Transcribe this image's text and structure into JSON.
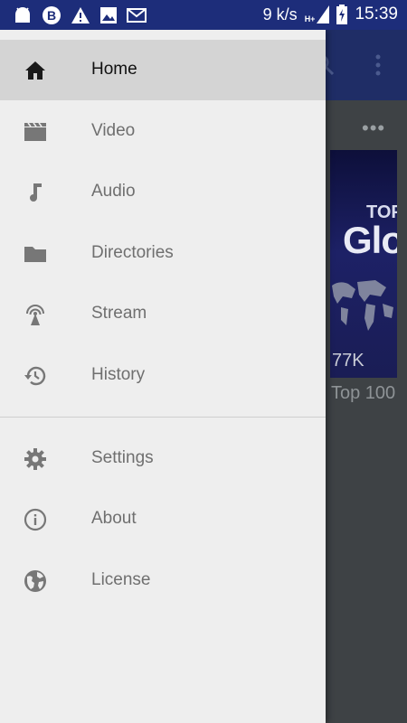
{
  "status_bar": {
    "speed": "9 k/s",
    "network": "H+",
    "time": "15:39"
  },
  "background": {
    "video_title_partial": "Top 100",
    "thumb_title_top": "TOP",
    "thumb_title_big": "Glo",
    "thumb_views": "77K"
  },
  "drawer": {
    "items": [
      {
        "label": "Home",
        "icon": "home-icon",
        "active": true
      },
      {
        "label": "Video",
        "icon": "video-icon"
      },
      {
        "label": "Audio",
        "icon": "music-note-icon"
      },
      {
        "label": "Directories",
        "icon": "folder-icon"
      },
      {
        "label": "Stream",
        "icon": "stream-antenna-icon"
      },
      {
        "label": "History",
        "icon": "history-icon"
      }
    ],
    "secondary_items": [
      {
        "label": "Settings",
        "icon": "gear-icon"
      },
      {
        "label": "About",
        "icon": "info-icon"
      },
      {
        "label": "License",
        "icon": "globe-icon"
      }
    ]
  },
  "colors": {
    "status_bar": "#1d2d7a",
    "drawer_bg": "#eeeeee",
    "active_item_bg": "#d4d4d4",
    "inactive_text": "#6f6f6f"
  }
}
